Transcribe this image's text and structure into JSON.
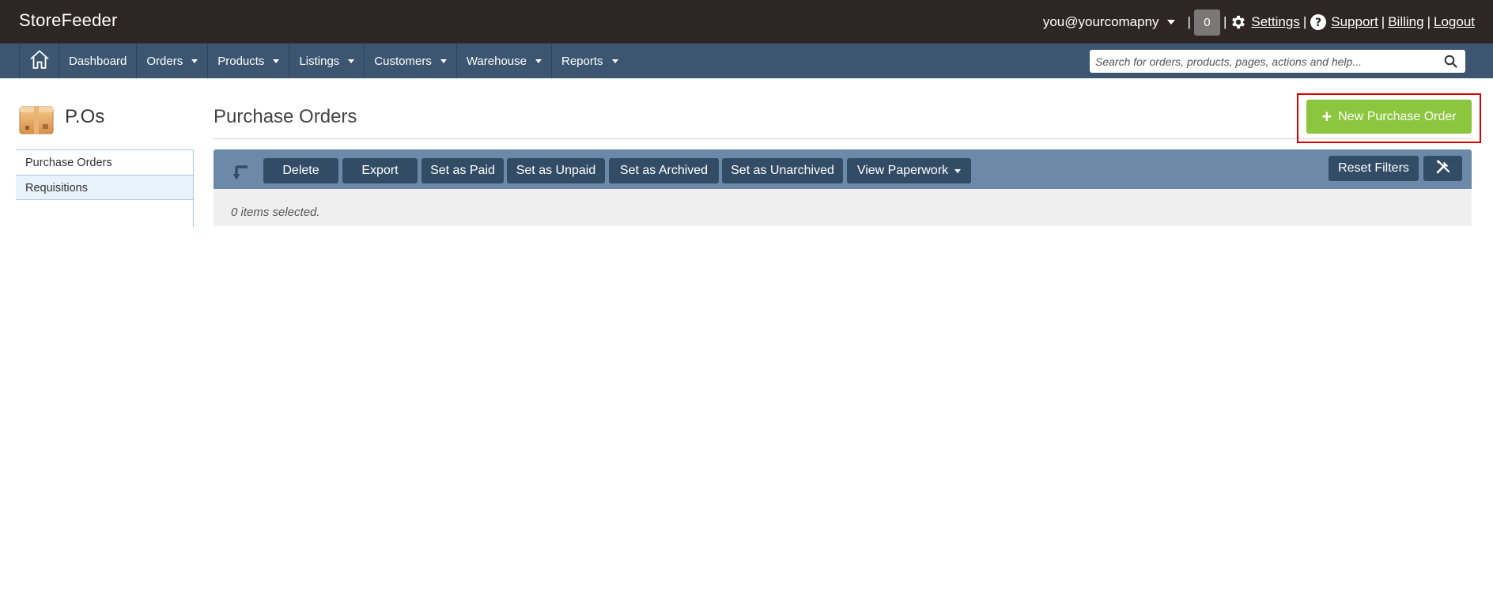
{
  "app": {
    "brand": "StoreFeeder"
  },
  "topbar": {
    "user_email": "you@yourcomapny",
    "separator": "|",
    "notification_count": "0",
    "links": {
      "settings": "Settings",
      "support": "Support",
      "billing": "Billing",
      "logout": "Logout"
    }
  },
  "nav": {
    "items": [
      {
        "label": "Dashboard",
        "has_dropdown": false
      },
      {
        "label": "Orders",
        "has_dropdown": true
      },
      {
        "label": "Products",
        "has_dropdown": true
      },
      {
        "label": "Listings",
        "has_dropdown": true
      },
      {
        "label": "Customers",
        "has_dropdown": true
      },
      {
        "label": "Warehouse",
        "has_dropdown": true
      },
      {
        "label": "Reports",
        "has_dropdown": true
      }
    ],
    "search_placeholder": "Search for orders, products, pages, actions and help..."
  },
  "sidebar": {
    "title": "P.Os",
    "items": [
      {
        "label": "Purchase Orders"
      },
      {
        "label": "Requisitions"
      }
    ]
  },
  "main": {
    "title": "Purchase Orders",
    "new_button": "New Purchase Order",
    "toolbar": {
      "buttons": [
        "Delete",
        "Export",
        "Set as Paid",
        "Set as Unpaid",
        "Set as Archived",
        "Set as Unarchived",
        "View Paperwork"
      ],
      "reset_filters": "Reset Filters"
    },
    "status_text": "0 items selected."
  },
  "colors": {
    "topbar_bg": "#2d2625",
    "navbar_bg": "#3c5671",
    "toolbar_bg": "#6c8aa8",
    "button_bg": "#334c66",
    "accent_green": "#8cc63f",
    "highlight_red": "#d90000"
  }
}
